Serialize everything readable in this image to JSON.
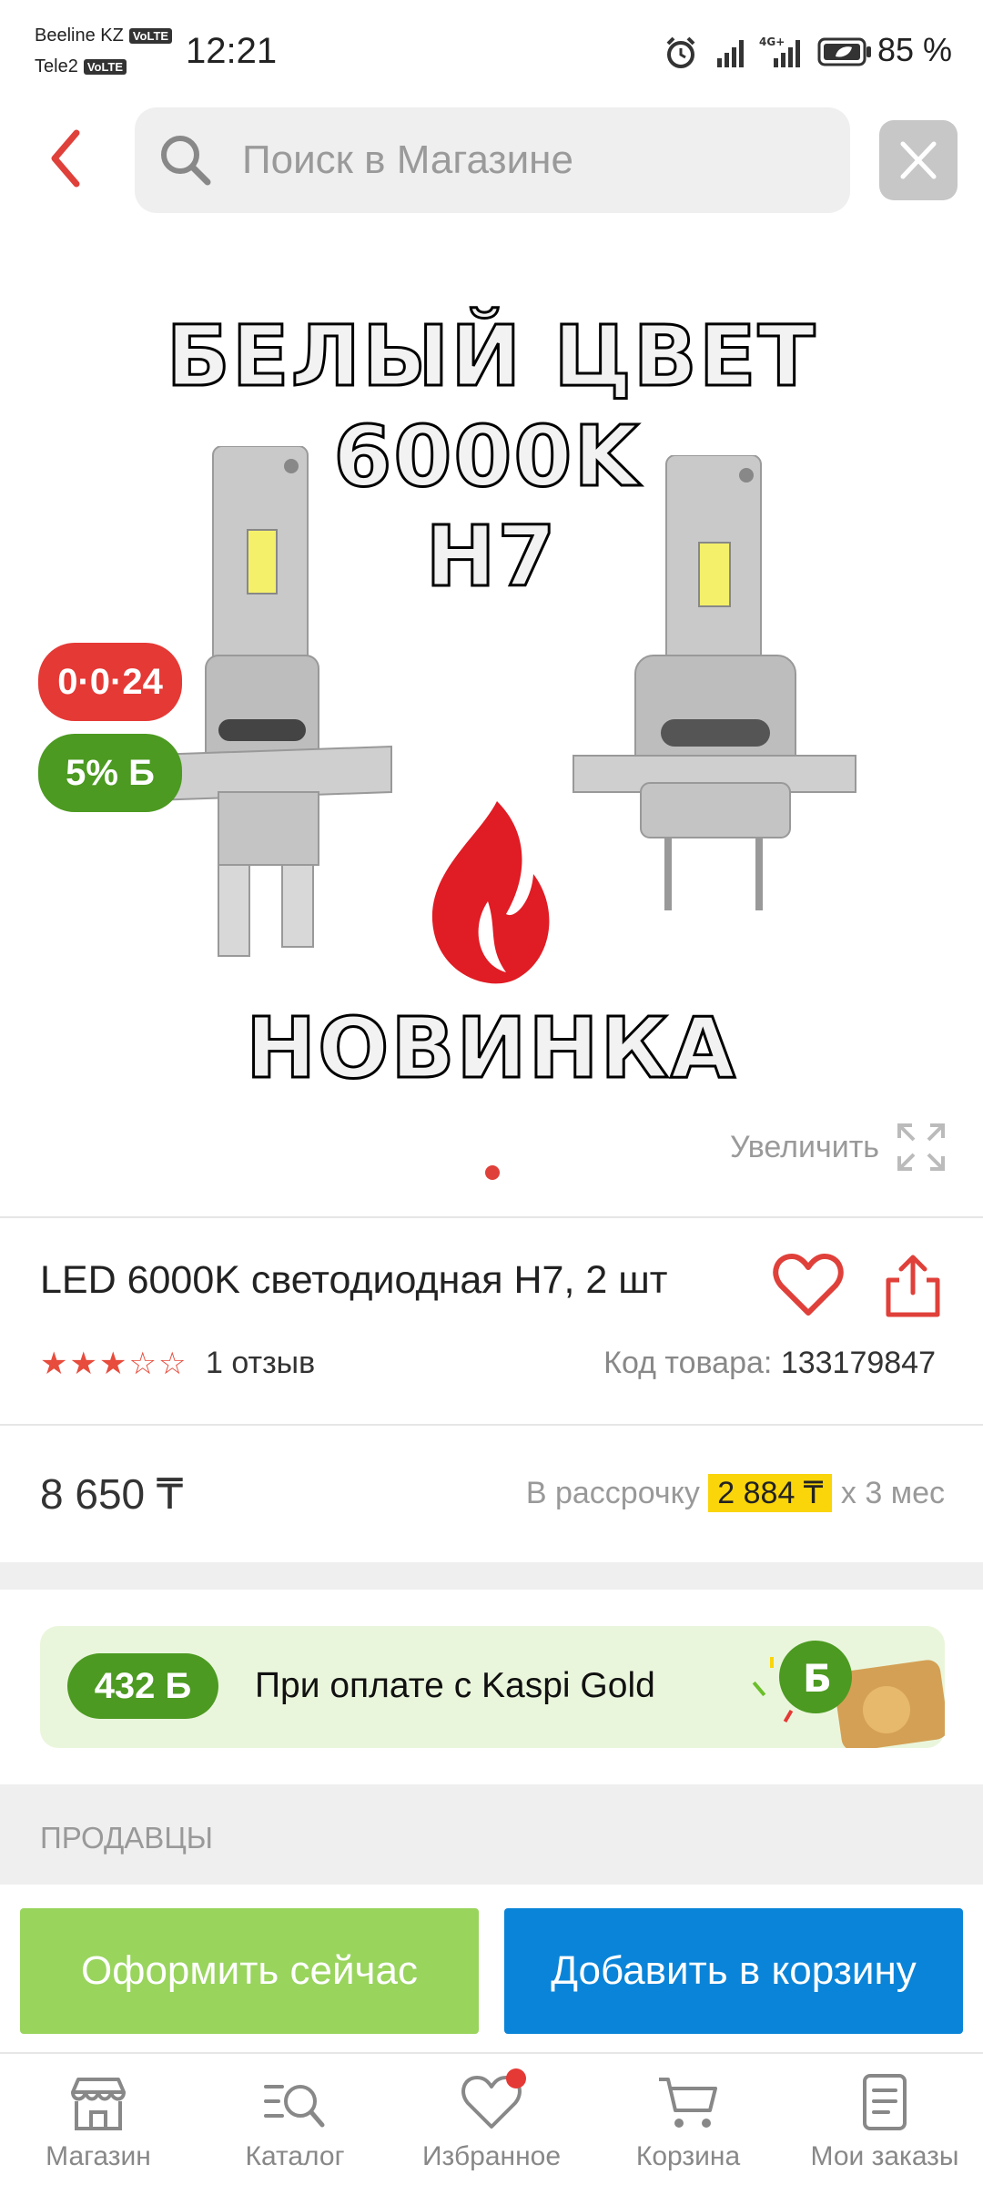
{
  "status_bar": {
    "carrier1": "Beeline KZ",
    "carrier2": "Tele2",
    "volte": "VoLTE",
    "time": "12:21",
    "network": "4G+",
    "battery": "85 %"
  },
  "search": {
    "placeholder": "Поиск в Магазине"
  },
  "product_image": {
    "line1": "БЕЛЫЙ ЦВЕТ",
    "line2": "6000K",
    "line3": "H7",
    "line4": "НОВИНКА",
    "badge_installment": "0·0·24",
    "badge_bonus": "5% Б",
    "zoom_label": "Увеличить"
  },
  "product": {
    "title": "LED 6000K светодиодная H7, 2 шт",
    "rating": 3,
    "rating_max": 5,
    "reviews": "1 отзыв",
    "sku_label": "Код товара:",
    "sku": "133179847",
    "price": "8 650 ₸",
    "installment_prefix": "В рассрочку",
    "installment_amount": "2 884 ₸",
    "installment_suffix": "x 3 мес"
  },
  "kaspi_gold": {
    "bonus": "432 Б",
    "text": "При оплате с Kaspi Gold"
  },
  "sellers_heading": "ПРОДАВЦЫ",
  "actions": {
    "checkout": "Оформить сейчас",
    "add_to_cart": "Добавить в корзину"
  },
  "bottom_nav": [
    {
      "label": "Магазин",
      "icon": "store-icon"
    },
    {
      "label": "Каталог",
      "icon": "catalog-search-icon"
    },
    {
      "label": "Избранное",
      "icon": "heart-icon"
    },
    {
      "label": "Корзина",
      "icon": "cart-icon"
    },
    {
      "label": "Мои заказы",
      "icon": "orders-icon"
    }
  ],
  "colors": {
    "accent_red": "#e0403a",
    "kaspi_green": "#4c9a21",
    "checkout_green": "#99d45d",
    "cart_blue": "#0a84d8",
    "installment_yellow": "#f9d50a"
  }
}
